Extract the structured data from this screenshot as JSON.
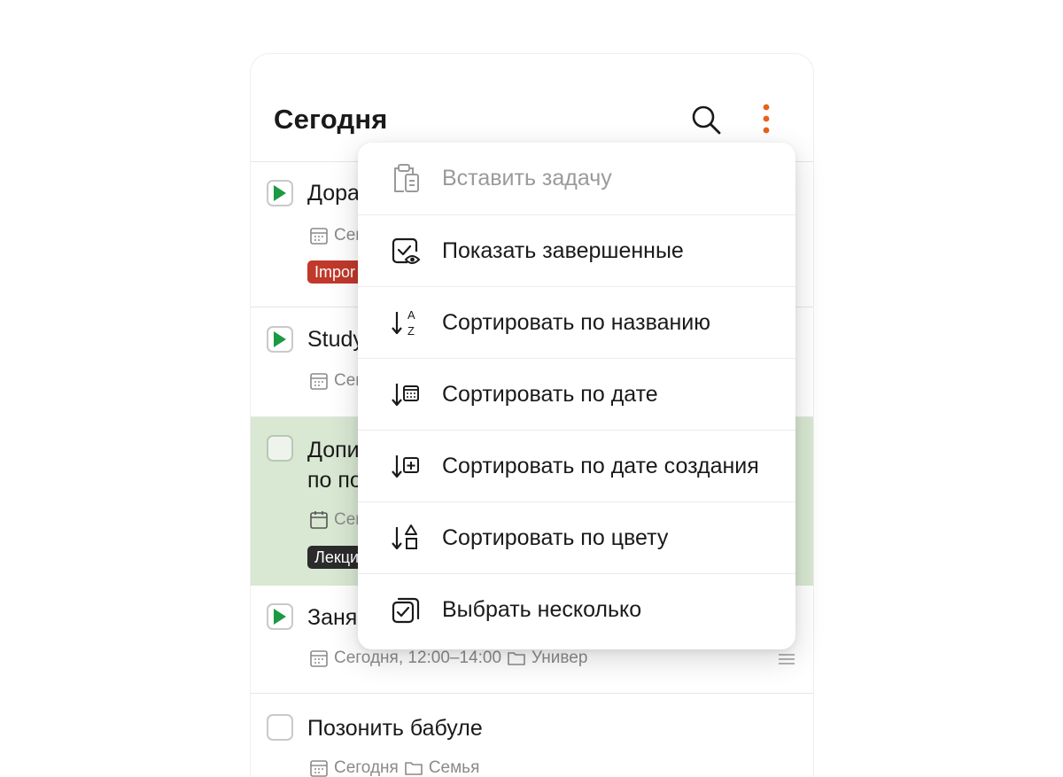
{
  "header": {
    "title": "Сегодня",
    "search_icon": "search-icon",
    "more_icon": "more-vertical-icon",
    "accent": "#e8611a"
  },
  "tasks": [
    {
      "name": "Дора",
      "meta_date": "Сег",
      "tag": "Impor",
      "tag_color": "#c0392b",
      "play": true
    },
    {
      "name": "Study",
      "meta_date": "Сег",
      "play": true
    },
    {
      "name": "Допи",
      "name_line2": "по по",
      "meta_date": "Сег",
      "tag": "Лекци",
      "tag_color": "#2b2b2b",
      "highlighted": true,
      "play": false
    },
    {
      "name": "Заня",
      "meta_date": "Сегодня, 12:00–14:00",
      "meta_folder": "Универ",
      "play": true,
      "has_notes": true
    },
    {
      "name": "Позонить бабуле",
      "meta_date": "Сегодня",
      "meta_folder": "Семья",
      "play": false
    }
  ],
  "menu": {
    "items": [
      {
        "label": "Вставить задачу",
        "icon": "paste-icon",
        "disabled": true
      },
      {
        "label": "Показать завершенные",
        "icon": "show-completed-icon"
      },
      {
        "label": "Сортировать по названию",
        "icon": "sort-az-icon"
      },
      {
        "label": "Сортировать по дате",
        "icon": "sort-date-icon"
      },
      {
        "label": "Сортировать по дате создания",
        "icon": "sort-created-icon"
      },
      {
        "label": "Сортировать по цвету",
        "icon": "sort-color-icon"
      },
      {
        "label": "Выбрать несколько",
        "icon": "select-multiple-icon"
      }
    ]
  },
  "colors": {
    "highlight": "#d8e8d2",
    "play": "#1a9a43",
    "important": "#c0392b"
  }
}
